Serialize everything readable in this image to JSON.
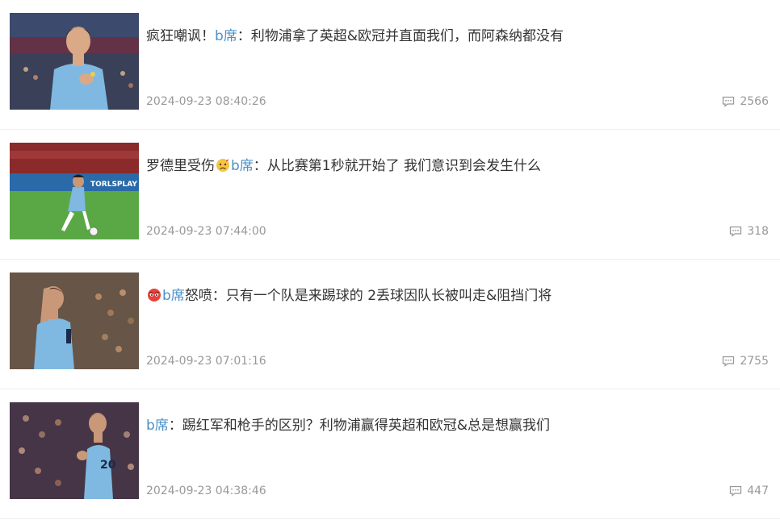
{
  "articles": [
    {
      "title_pre": "疯狂嘲讽！",
      "title_hl": "b席",
      "title_post": "：利物浦拿了英超&欧冠并直面我们，而阿森纳都没有",
      "time": "2024-09-23 08:40:26",
      "comments": "2566",
      "thumb_icon": "player-photo"
    },
    {
      "title_pre": "罗德里受伤",
      "title_emoji": "sad-face-emoji",
      "title_hl": "b席",
      "title_post": "：从比赛第1秒就开始了 我们意识到会发生什么",
      "time": "2024-09-23 07:44:00",
      "comments": "318",
      "thumb_icon": "player-photo"
    },
    {
      "title_emoji": "angry-face-emoji",
      "title_hl": "b席",
      "title_post": "怒喷：只有一个队是来踢球的 2丢球因队长被叫走&阻挡门将",
      "time": "2024-09-23 07:01:16",
      "comments": "2755",
      "thumb_icon": "player-photo"
    },
    {
      "title_hl": "b席",
      "title_post": "：踢红军和枪手的区别？利物浦赢得英超和欧冠&总是想赢我们",
      "time": "2024-09-23 04:38:46",
      "comments": "447",
      "thumb_icon": "player-photo"
    }
  ],
  "colors": {
    "highlight": "#4a90c8",
    "text": "#333333",
    "meta": "#999999"
  }
}
